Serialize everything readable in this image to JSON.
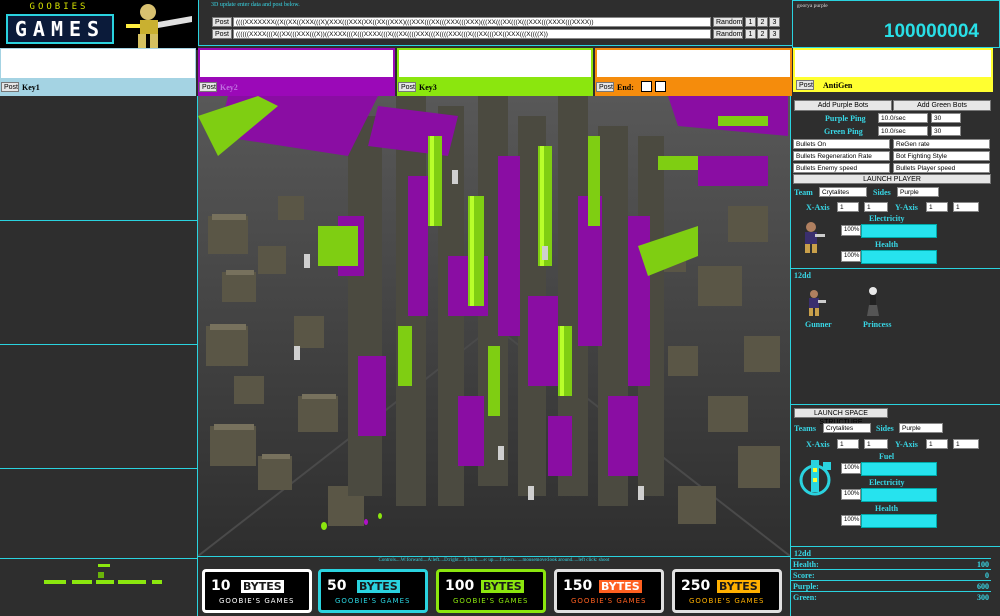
{
  "header": {
    "logo_text_top": "GOOBIES",
    "logo_text_main": "GAMES",
    "instruction": "3D update enter data and post below.",
    "post_label": "Post",
    "post_rows": [
      {
        "value": "((((XXXXXXX((X((XX((XXX(((X)(XXX(((XXX(XX((XX((XXX)(((XXX(((XX(((XXX(((XXX)(((XX(((XX(((X(((XXX(((XXXX(((XXXX))",
        "random": "Random",
        "n1": "1",
        "n2": "2",
        "n3": "3"
      },
      {
        "value": "((((((XXXX(((X((XX(((XXX(((X))((XXXX(((X(((XXXX(((X(((XX((((XXX(((X((((XXX(((X(((XX(((XX((XXX(((X((((X))",
        "random": "Random",
        "n1": "1",
        "n2": "2",
        "n3": "3"
      }
    ],
    "team_label": "goorya purple",
    "score": "100000004"
  },
  "keys": [
    {
      "label": "Key1",
      "post": "Post",
      "color": "#a4d3e3"
    },
    {
      "label": "Key2",
      "post": "Post",
      "color": "#9b09b8"
    },
    {
      "label": "Key3",
      "post": "Post",
      "color": "#8be60e"
    },
    {
      "label": "End:",
      "post": "Post",
      "color": "#f58c0c"
    },
    {
      "label": "AntiGen",
      "post": "Post",
      "color": "#ffff30"
    }
  ],
  "controls": {
    "add_purple": "Add Purple Bots",
    "add_green": "Add Green Bots",
    "purple_ping_label": "Purple Ping",
    "purple_ping_rate": "10.0/sec",
    "purple_ping_count": "30",
    "green_ping_label": "Green  Ping",
    "green_ping_rate": "10.0/sec",
    "green_ping_count": "30",
    "settings": [
      "Bullets On",
      "ReGen rate",
      "Bullets Regeneration Rate",
      "Bot Fighting Style",
      "Bullets Enemy speed",
      "Bullets Player speed"
    ],
    "launch_player": "LAUNCH PLAYER",
    "team_label": "Team",
    "team_value": "Crytalites",
    "sides_label": "Sides",
    "sides_value": "Purple",
    "xaxis_label": "X-Axis",
    "yaxis_label": "Y-Axis",
    "axis_value": "1",
    "electricity_label": "Electricity",
    "health_label": "Health",
    "percent": "100%",
    "player_name": "12dd",
    "characters": [
      "Gunner",
      "Princess"
    ]
  },
  "space": {
    "launch": "LAUNCH SPACE STRUCTURE",
    "teams_label": "Teams",
    "teams_value": "Crytalites",
    "sides_label": "Sides",
    "sides_value": "Purple",
    "xaxis_label": "X-Axis",
    "yaxis_label": "Y-Axis",
    "axis_value": "1",
    "fuel_label": "Fuel",
    "electricity_label": "Electricity",
    "health_label": "Health",
    "percent": "100%"
  },
  "stats": {
    "name": "12dd",
    "rows": [
      {
        "label": "Health:",
        "value": "100"
      },
      {
        "label": "Score:",
        "value": "0"
      },
      {
        "label": "Purple:",
        "value": "600"
      },
      {
        "label": "Green:",
        "value": "300"
      }
    ]
  },
  "footer": {
    "controls_text": "Controls....W:forward....A:left....D:right....S:back.....e: up.....f:down.......mousemove:look around.....left click: shoot",
    "banners": [
      {
        "big": "10",
        "word": "BYTES",
        "sub": "GOOBIE'S GAMES",
        "accent": "#ffffff"
      },
      {
        "big": "50",
        "word": "BYTES",
        "sub": "GOOBIE'S GAMES",
        "accent": "#2ad3df"
      },
      {
        "big": "100",
        "word": "BYTES",
        "sub": "GOOBIE'S GAMES",
        "accent": "#8be60e"
      },
      {
        "big": "150",
        "word": "BYTES",
        "sub": "GOOBIE'S GAMES",
        "accent": "#ff6020"
      },
      {
        "big": "250",
        "word": "BYTES",
        "sub": "GOOBIE'S GAMES",
        "accent": "#ffb000"
      }
    ]
  },
  "colors": {
    "cyan": "#2ad3df",
    "purple": "#9b09b8",
    "green": "#8be60e",
    "orange": "#f58c0c",
    "yellow": "#ffff30"
  }
}
